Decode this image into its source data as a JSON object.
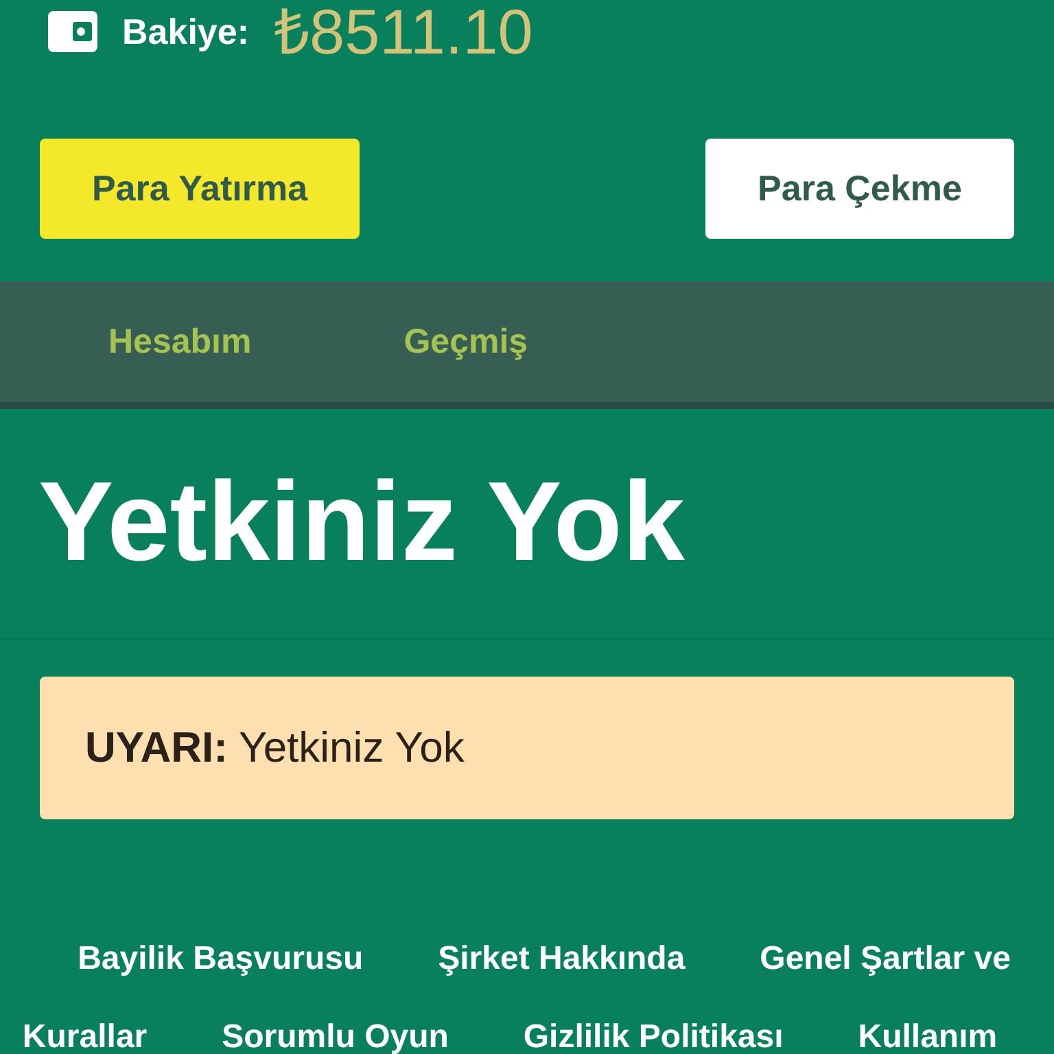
{
  "header": {
    "balance_label": "Bakiye:",
    "balance_amount": "₺8511.10"
  },
  "actions": [
    {
      "label": "Para Yatırma",
      "kind": "primary"
    },
    {
      "label": "Para Çekme",
      "kind": "secondary"
    }
  ],
  "tabs": [
    {
      "label": "Hesabım"
    },
    {
      "label": "Geçmiş"
    }
  ],
  "page_title": "Yetkiniz Yok",
  "alert": {
    "text": "**UYARI:** Yetkiniz Yok"
  },
  "footer_links": [
    {
      "lines": [
        "Bayilik Başvurusu"
      ]
    },
    {
      "lines": [
        "Şirket Hakkında"
      ]
    },
    {
      "lines": [
        "Genel Şartlar ve",
        "Kurallar"
      ]
    },
    {
      "lines": [
        "Sorumlu Oyun"
      ]
    },
    {
      "lines": [
        "Gizlilik Politikası"
      ]
    },
    {
      "lines": [
        "Kullanım"
      ]
    }
  ]
}
